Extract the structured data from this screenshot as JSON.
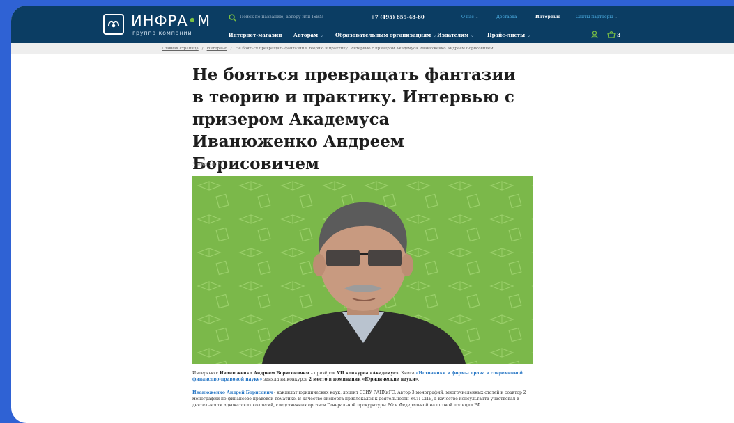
{
  "header": {
    "logo_main": "ИНФРА",
    "logo_dot": "•",
    "logo_m": "М",
    "logo_sub": "группа компаний",
    "search_placeholder": "Поиск по названию, автору или ISBN",
    "phone": "+7 (495) 859-48-60",
    "top_links": [
      {
        "label": "О нас",
        "chevron": "⌄"
      },
      {
        "label": "Доставка",
        "chevron": ""
      },
      {
        "label": "Интервью",
        "chevron": ""
      },
      {
        "label": "Сайты-партнеры",
        "chevron": "⌄"
      }
    ],
    "main_nav": [
      {
        "label": "Интернет-магазин",
        "chevron": ""
      },
      {
        "label": "Авторам",
        "chevron": "⌄"
      },
      {
        "label": "Образовательным организациям",
        "chevron": "⌄"
      },
      {
        "label": "Издателям",
        "chevron": "⌄"
      },
      {
        "label": "Прайс-листы",
        "chevron": "⌄"
      }
    ],
    "cart_count": "3"
  },
  "breadcrumb": {
    "home": "Главная страница",
    "section": "Интервью",
    "separator": "/",
    "current": "Не бояться превращать фантазии в теорию и практику. Интервью с призером Академуса Иванюженко Андреем Борисовичем"
  },
  "article": {
    "title": "Не бояться превращать фантазии в теорию и практику. Интервью с призером Академуса Иванюженко Андреем Борисовичем",
    "date": "3 мая 2023",
    "p1": {
      "t1": "Интервью с ",
      "name": "Иванюженко Андреем Борисовичем",
      "t2": " – призёром ",
      "contest": "VII конкурса «Академус»",
      "t3": ". Книга ",
      "book": "«Источники и формы права в современной финансово-правовой науке»",
      "t4": " заняла на конкурсе ",
      "place": "2 место в номинации «Юридические науки»",
      "t5": "."
    },
    "p2": {
      "name": "Иванюженко Андрей Борисович",
      "text": " - кандидат юридических наук, доцент СЗИУ РАНХиГС. Автор 3 монографий, многочисленных статей и соавтор 2 монографий по финансово-правовой тематике. В качестве эксперта привлекался к деятельности КСП СПБ, в качестве консультанта участвовал в деятельности адвокатских коллегий, следственных органов Генеральной прокуратуры РФ и Федеральной налоговой полиции РФ."
    }
  },
  "colors": {
    "header_bg": "#0b3d63",
    "accent_link": "#4fb3e8",
    "logo_green": "#7bc043",
    "photo_bg": "#7bb84a",
    "page_frame": "#2f62d4"
  }
}
